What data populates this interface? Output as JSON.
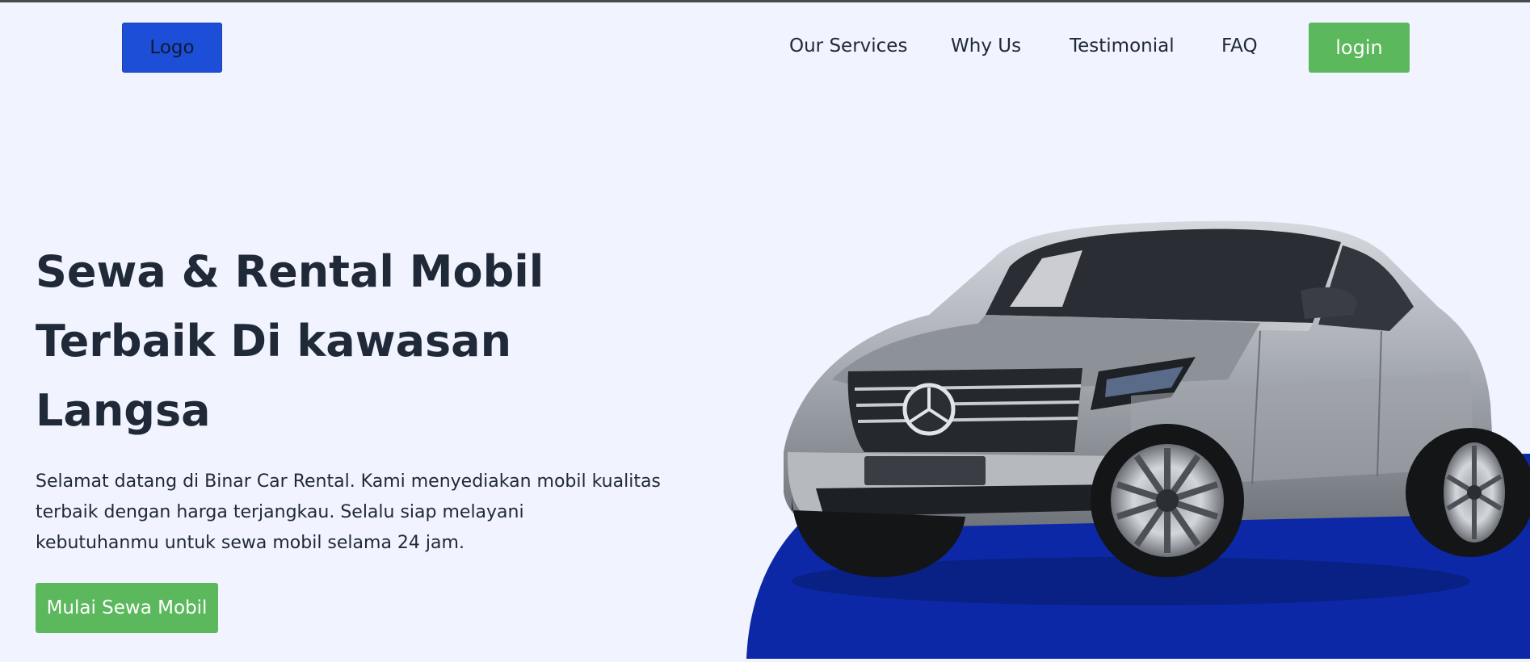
{
  "nav": {
    "logo_label": "Logo",
    "links": [
      "Our Services",
      "Why Us",
      "Testimonial",
      "FAQ"
    ],
    "login_label": "login"
  },
  "hero": {
    "title_lines": [
      "Sewa & Rental Mobil",
      "Terbaik Di kawasan",
      "Langsa"
    ],
    "description_lines": [
      "Selamat datang di Binar Car Rental. Kami menyediakan mobil kualitas",
      "terbaik dengan harga terjangkau. Selalu siap melayani",
      "kebutuhanmu untuk sewa mobil selama 24 jam."
    ],
    "cta_label": "Mulai Sewa Mobil",
    "image": "silver-suv-car-image"
  },
  "colors": {
    "background": "#f1f3fe",
    "logo": "#1d4ed8",
    "primary_green": "#5cb85c",
    "hero_blue": "#0d28a6",
    "text": "#1f2937"
  }
}
